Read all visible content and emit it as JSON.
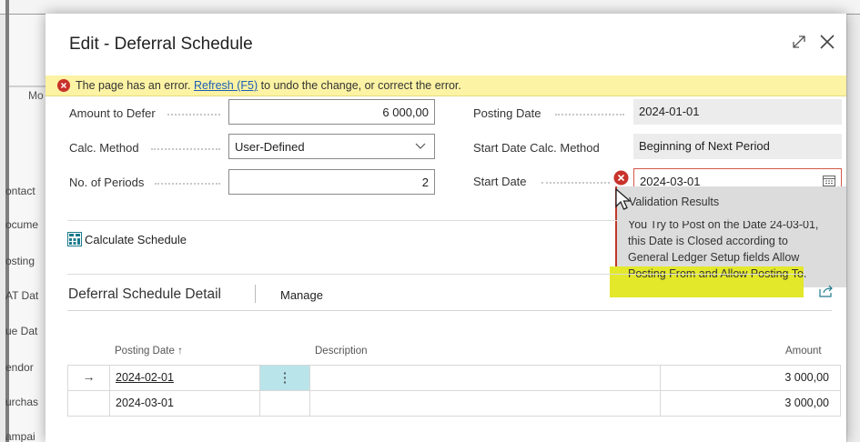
{
  "background": {
    "left_nav": [
      "ontact",
      "ocume",
      "osting",
      "AT Dat",
      "ue Dat",
      "endor",
      "urchas",
      "ampai"
    ],
    "left_header": "Mo"
  },
  "dialog": {
    "title": "Edit - Deferral Schedule",
    "icons": [
      "expand-icon",
      "close-icon"
    ]
  },
  "error_bar": {
    "text_before": "The page has an error.",
    "link": "Refresh (F5)",
    "text_after": "to undo the change, or correct the error.",
    "color": "#fdf3a4"
  },
  "fields": {
    "amount_label": "Amount to Defer",
    "amount_value": "6 000,00",
    "calc_method_label": "Calc. Method",
    "calc_method_value": "User-Defined",
    "periods_label": "No. of Periods",
    "periods_value": "2",
    "posting_date_label": "Posting Date",
    "posting_date_value": "2024-01-01",
    "start_calc_label": "Start Date Calc. Method",
    "start_calc_value": "Beginning of Next Period",
    "start_date_label": "Start Date",
    "start_date_value": "2024-03-01"
  },
  "validation": {
    "title": "Validation Results",
    "line1": "You Try to Post on the Date 24-03-01,",
    "line2": "this Date is Closed according to",
    "line3": "General Ledger Setup fields Allow",
    "line4": "Posting From and Allow Posting To."
  },
  "actions": {
    "calculate": "Calculate Schedule"
  },
  "detail": {
    "title": "Deferral Schedule Detail",
    "manage": "Manage",
    "columns": {
      "posting_date": "Posting Date",
      "sort_indicator": "↑",
      "description": "Description",
      "amount": "Amount"
    },
    "rows": [
      {
        "marker": "→",
        "posting_date": "2024-02-01",
        "description": "",
        "amount": "3 000,00",
        "menu": "⋮"
      },
      {
        "marker": "",
        "posting_date": "2024-03-01",
        "description": "",
        "amount": "3 000,00",
        "menu": ""
      }
    ]
  }
}
